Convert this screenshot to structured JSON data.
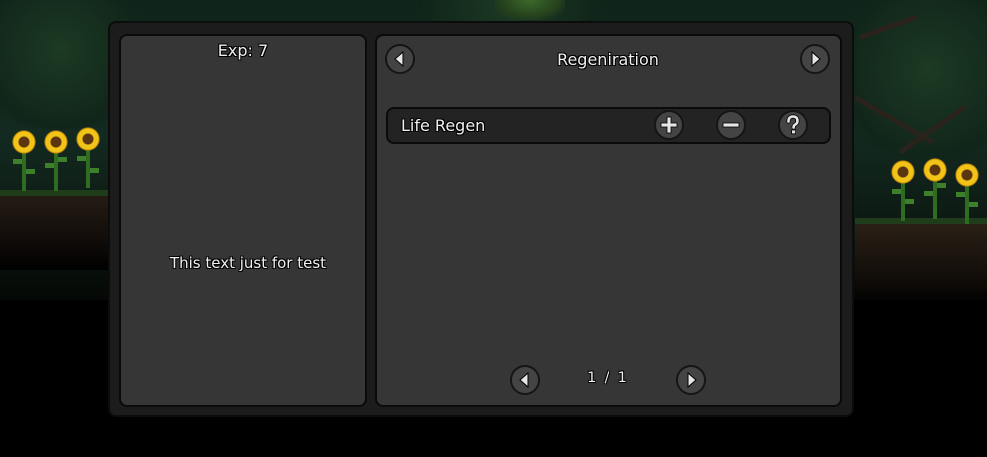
{
  "left_panel": {
    "exp_label": "Exp: 7",
    "test_text": "This text just for test"
  },
  "category": {
    "title": "Regeniration",
    "prev_icon": "arrow-left-icon",
    "next_icon": "arrow-right-icon"
  },
  "skills": [
    {
      "label": "Life Regen",
      "add_icon": "plus-icon",
      "remove_icon": "minus-icon",
      "help_icon": "question-icon"
    }
  ],
  "pagination": {
    "indicator": "1 / 1",
    "prev_icon": "arrow-left-icon",
    "next_icon": "arrow-right-icon"
  },
  "colors": {
    "panel_bg": "#363636",
    "frame_bg": "#1c1c1c",
    "button_bg": "#444444",
    "icon_color": "#e6e6e6",
    "text_color": "#f0f0f0",
    "sunflower_petal": "#f2c418"
  }
}
